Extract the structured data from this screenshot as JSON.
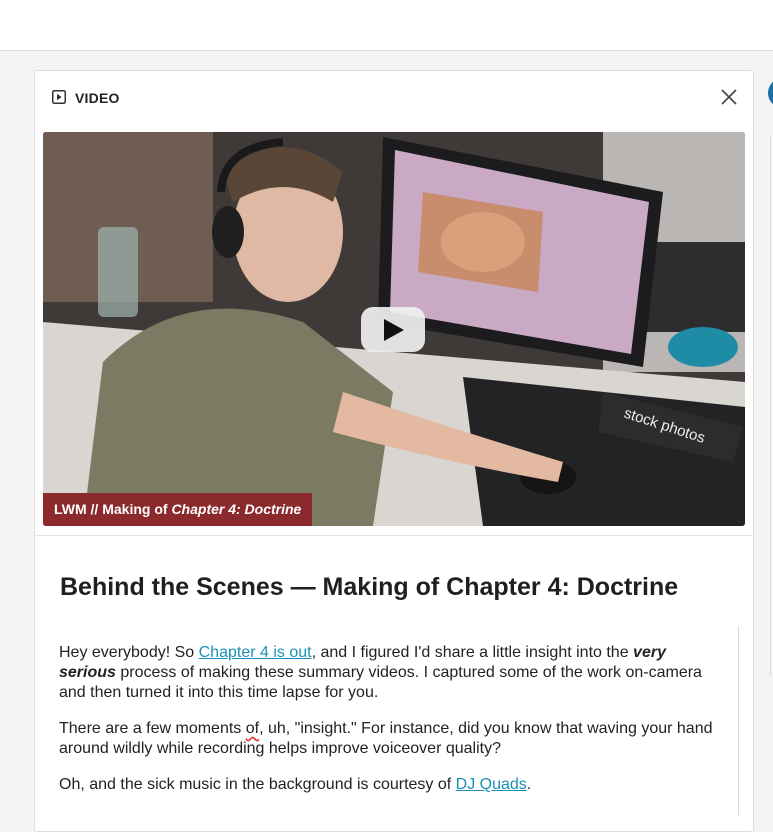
{
  "header": {
    "label": "VIDEO",
    "icon": "video-icon",
    "close_icon": "close-icon"
  },
  "video": {
    "caption_prefix": "LWM // Making of ",
    "caption_italic": "Chapter 4: Doctrine",
    "overlay_text": "stock photos",
    "play_icon": "play-icon"
  },
  "article": {
    "title": "Behind the Scenes — Making of Chapter 4: Doctrine",
    "p1_a": "Hey everybody! So ",
    "p1_link": "Chapter 4 is out",
    "p1_b": ", and I figured I'd share a little insight into the ",
    "p1_bold": "very serious",
    "p1_c": " process of making these summary videos. I captured some of the work on-camera and then turned it into this time lapse for you.",
    "p2_a": "There are a few moments ",
    "p2_misspelled": "of",
    "p2_b": ", uh, \"insight.\" For instance, did you know that waving your hand around wildly while recording helps improve voiceover quality?",
    "p3_a": "Oh, and the sick music in the background is courtesy of ",
    "p3_link": "DJ Quads",
    "p3_b": "."
  },
  "colors": {
    "link": "#1a8fb9",
    "caption_bg": "#8a2a2c",
    "avatar": "#1d6fa6"
  }
}
